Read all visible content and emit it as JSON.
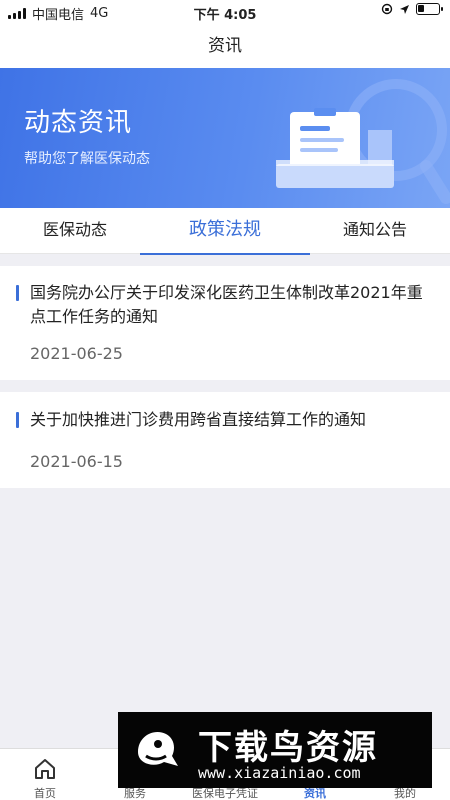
{
  "status_bar": {
    "carrier": "中国电信",
    "network": "4G",
    "time": "下午 4:05",
    "icons": [
      "signal-icon",
      "lock-rotation-icon",
      "location-arrow-icon",
      "battery-icon"
    ]
  },
  "nav": {
    "title": "资讯"
  },
  "banner": {
    "title": "动态资讯",
    "subtitle": "帮助您了解医保动态",
    "illustration": "document-tray-magnifier-icon"
  },
  "tabs": [
    {
      "label": "医保动态",
      "active": false
    },
    {
      "label": "政策法规",
      "active": true
    },
    {
      "label": "通知公告",
      "active": false
    }
  ],
  "articles": [
    {
      "title": "国务院办公厅关于印发深化医药卫生体制改革2021年重点工作任务的通知",
      "date": "2021-06-25"
    },
    {
      "title": "关于加快推进门诊费用跨省直接结算工作的通知",
      "date": "2021-06-15"
    }
  ],
  "tabbar": [
    {
      "label": "首页",
      "icon": "home-icon",
      "active": false
    },
    {
      "label": "服务",
      "icon": "service-icon",
      "active": false
    },
    {
      "label": "医保电子凭证",
      "icon": "card-icon",
      "active": false
    },
    {
      "label": "资讯",
      "icon": "news-icon",
      "active": true
    },
    {
      "label": "我的",
      "icon": "user-icon",
      "active": false
    }
  ],
  "watermark": {
    "name": "下载鸟资源",
    "url": "www.xiazainiao.com"
  },
  "colors": {
    "accent": "#3b6fd8",
    "banner_start": "#3f73e6",
    "banner_end": "#7aa5f5",
    "background": "#efeff4"
  }
}
